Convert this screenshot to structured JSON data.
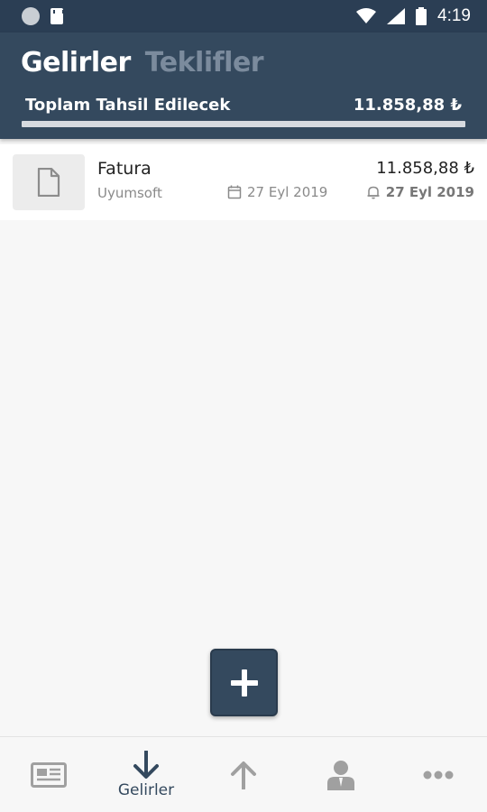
{
  "status_bar": {
    "time": "4:19",
    "icons": [
      "notification-dot-icon",
      "sd-card-icon",
      "wifi-icon",
      "signal-icon",
      "battery-icon"
    ]
  },
  "header": {
    "tabs": [
      {
        "label": "Gelirler",
        "active": true
      },
      {
        "label": "Teklifler",
        "active": false
      }
    ],
    "summary_label": "Toplam Tahsil Edilecek",
    "summary_amount": "11.858,88 ₺",
    "collected_fraction": 0
  },
  "list": {
    "items": [
      {
        "title": "Fatura",
        "customer": "Uyumsoft",
        "date": "27 Eyl 2019",
        "amount": "11.858,88 ₺",
        "due_date": "27 Eyl 2019",
        "icon": "document-icon"
      }
    ]
  },
  "fab": {
    "icon": "plus-icon"
  },
  "bottom_nav": {
    "items": [
      {
        "icon": "newspaper-icon",
        "label": "",
        "active": false
      },
      {
        "icon": "arrow-down-icon",
        "label": "Gelirler",
        "active": true
      },
      {
        "icon": "arrow-up-icon",
        "label": "",
        "active": false
      },
      {
        "icon": "person-icon",
        "label": "",
        "active": false
      },
      {
        "icon": "more-icon",
        "label": "",
        "active": false
      }
    ]
  },
  "colors": {
    "primary": "#34495e",
    "status_bar": "#2b3e54",
    "inactive_tab": "#7b8b9d",
    "nav_inactive": "#a0a0a0"
  }
}
